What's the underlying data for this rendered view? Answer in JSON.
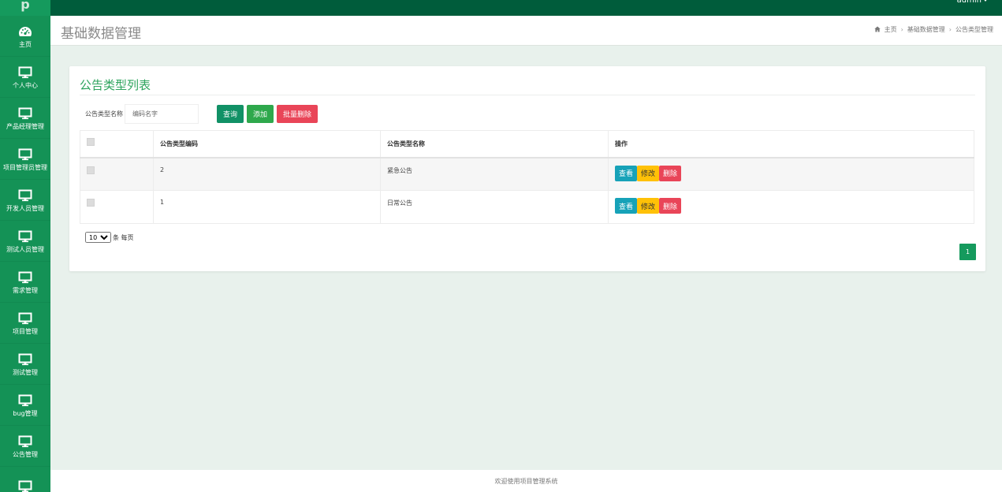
{
  "brand": {
    "logo_text": "p"
  },
  "user": {
    "name": "admin"
  },
  "sidebar": {
    "items": [
      {
        "label": "主页",
        "icon": "dashboard-icon"
      },
      {
        "label": "个人中心",
        "icon": "monitor-icon"
      },
      {
        "label": "产品经理管理",
        "icon": "monitor-icon"
      },
      {
        "label": "项目管理员管理",
        "icon": "monitor-icon"
      },
      {
        "label": "开发人员管理",
        "icon": "monitor-icon"
      },
      {
        "label": "测试人员管理",
        "icon": "monitor-icon"
      },
      {
        "label": "需求管理",
        "icon": "monitor-icon"
      },
      {
        "label": "项目管理",
        "icon": "monitor-icon"
      },
      {
        "label": "测试管理",
        "icon": "monitor-icon"
      },
      {
        "label": "bug管理",
        "icon": "monitor-icon"
      },
      {
        "label": "公告管理",
        "icon": "monitor-icon"
      },
      {
        "label": "",
        "icon": "monitor-icon"
      }
    ]
  },
  "header": {
    "title": "基础数据管理",
    "breadcrumb": [
      "主页",
      "基础数据管理",
      "公告类型管理"
    ]
  },
  "card": {
    "title": "公告类型列表"
  },
  "search": {
    "label": "公告类型名称",
    "placeholder": "编码名字",
    "query_label": "查询",
    "add_label": "添加",
    "batch_delete_label": "批量删除"
  },
  "table": {
    "columns": [
      "",
      "公告类型编码",
      "公告类型名称",
      "操作"
    ],
    "rows": [
      {
        "code": "2",
        "name": "紧急公告"
      },
      {
        "code": "1",
        "name": "日常公告"
      }
    ],
    "actions": {
      "view": "查看",
      "edit": "修改",
      "delete": "删除"
    }
  },
  "pagination": {
    "page_size": "10",
    "page_size_suffix": "条 每页",
    "current_page": "1"
  },
  "footer": {
    "text": "欢迎使用项目管理系统"
  },
  "colors": {
    "topbar": "#005c3b",
    "sidebar": "#149256",
    "accent": "#2ea45e",
    "view": "#17a2b8",
    "edit": "#ffc107",
    "delete": "#e94558"
  }
}
